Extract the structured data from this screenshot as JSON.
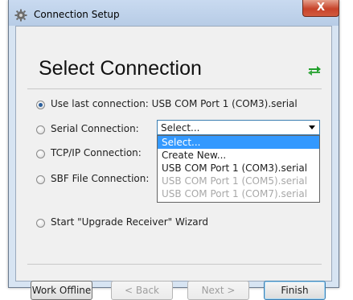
{
  "window": {
    "title": "Connection Setup",
    "close_label": "X"
  },
  "header": {
    "headline": "Select Connection"
  },
  "options": {
    "last": "Use last connection: USB COM Port 1 (COM3).serial",
    "serial": "Serial Connection:",
    "tcpip": "TCP/IP Connection:",
    "sbf": "SBF File Connection:",
    "wizard": "Start \"Upgrade Receiver\" Wizard"
  },
  "serial_select": {
    "value": "Select...",
    "options": [
      "Select...",
      "Create New...",
      "USB COM Port 1 (COM3).serial",
      "USB COM Port 1 (COM5).serial",
      "USB COM Port 1 (COM7).serial"
    ]
  },
  "buttons": {
    "work_offline": "Work Offline",
    "back": "< Back",
    "next": "Next >",
    "finish": "Finish"
  },
  "icons": {
    "window_icon": "gear-icon",
    "swap_icon": "swap-arrows-icon"
  },
  "colors": {
    "accent_green": "#22a02c",
    "selection_blue": "#3399ff"
  }
}
